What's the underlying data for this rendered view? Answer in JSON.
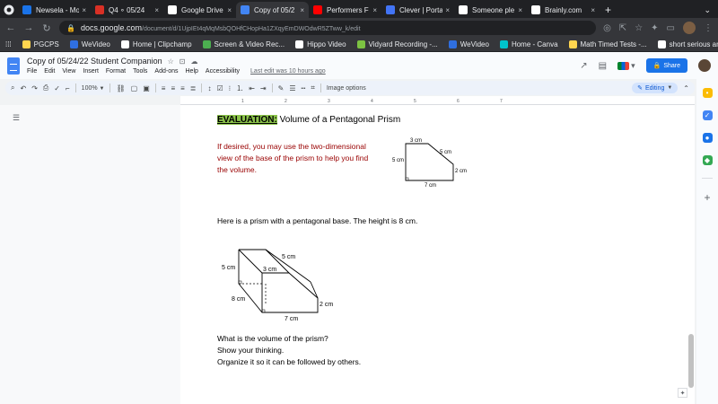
{
  "browser": {
    "tabs": [
      {
        "label": "Newsela - Mo",
        "color": "#1a73e8"
      },
      {
        "label": "Q4 ∘ 05/24",
        "color": "#d93025"
      },
      {
        "label": "Google Drive",
        "color": "#ffffff"
      },
      {
        "label": "Copy of 05/2",
        "color": "#4285f4",
        "active": true
      },
      {
        "label": "Performers F",
        "color": "#ff0000"
      },
      {
        "label": "Clever | Porta",
        "color": "#4274f6"
      },
      {
        "label": "Someone ple",
        "color": "#ffffff"
      },
      {
        "label": "Brainly.com",
        "color": "#ffffff"
      }
    ],
    "new_tab": "+",
    "url_host": "docs.google.com",
    "url_path": "/document/d/1UjpIEt4qMqMsbQOHfCHopHa1ZXqyEmDWOdwR5ZTww_k/edit",
    "bookmarks": [
      {
        "label": "PGCPS",
        "color": "#ffd54f"
      },
      {
        "label": "WeVideo",
        "color": "#2f6fe0"
      },
      {
        "label": "Home | Clipchamp",
        "color": "#ffffff"
      },
      {
        "label": "Screen & Video Rec...",
        "color": "#4caf50"
      },
      {
        "label": "Hippo Video",
        "color": "#ffffff"
      },
      {
        "label": "Vidyard Recording -...",
        "color": "#7cc242"
      },
      {
        "label": "WeVideo",
        "color": "#2f6fe0"
      },
      {
        "label": "Home - Canva",
        "color": "#00c4cc"
      },
      {
        "label": "Math Timed Tests -...",
        "color": "#ffd54f"
      },
      {
        "label": "short serious anim...",
        "color": "#ffffff"
      }
    ]
  },
  "docs": {
    "title": "Copy of 05/24/22  Student Companion",
    "menu": [
      "File",
      "Edit",
      "View",
      "Insert",
      "Format",
      "Tools",
      "Add-ons",
      "Help",
      "Accessibility"
    ],
    "last_edit": "Last edit was 10 hours ago",
    "share_label": "Share",
    "zoom": "100%",
    "image_options": "Image options",
    "mode": "Editing",
    "ruler_ticks": [
      "1",
      "2",
      "3",
      "4",
      "5",
      "6",
      "7"
    ]
  },
  "content": {
    "heading_highlight": "EVALUATION:",
    "heading_rest": " Volume of a Pentagonal Prism",
    "hint": "If desired, you may use the two-dimensional view of the base of the prism to help you find the volume.",
    "prism_intro": "Here is a prism with a pentagonal base. The height is 8 cm.",
    "question_lines": [
      "What is the volume of the prism?",
      "Show your thinking.",
      "Organize it so it can be followed by others."
    ],
    "base_labels": {
      "top": "3 cm",
      "slant": "5 cm",
      "left": "5 cm",
      "right": "2 cm",
      "bottom": "7 cm"
    },
    "prism_labels": {
      "slant": "5 cm",
      "left": "5 cm",
      "top": "3 cm",
      "depth": "8 cm",
      "right": "2 cm",
      "bottom": "7 cm"
    }
  }
}
